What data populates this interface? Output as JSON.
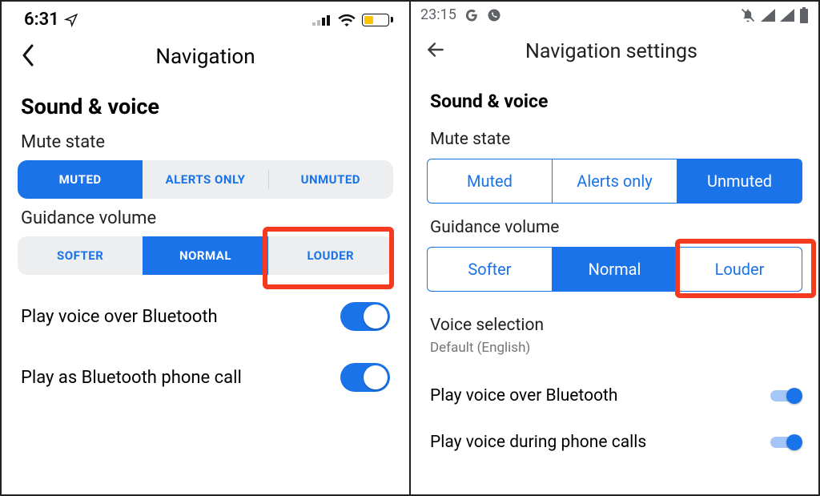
{
  "ios": {
    "status": {
      "time": "6:31"
    },
    "nav_title": "Navigation",
    "section_title": "Sound & voice",
    "mute_state": {
      "label": "Mute state",
      "options": [
        "MUTED",
        "ALERTS ONLY",
        "UNMUTED"
      ],
      "selected_index": 0
    },
    "guidance_volume": {
      "label": "Guidance volume",
      "options": [
        "SOFTER",
        "NORMAL",
        "LOUDER"
      ],
      "selected_index": 1,
      "highlighted_index": 2
    },
    "rows": {
      "play_bluetooth": {
        "label": "Play voice over Bluetooth",
        "on": true
      },
      "play_bt_call": {
        "label": "Play as Bluetooth phone call",
        "on": true
      }
    }
  },
  "android": {
    "status": {
      "time": "23:15"
    },
    "nav_title": "Navigation settings",
    "section_title": "Sound & voice",
    "mute_state": {
      "label": "Mute state",
      "options": [
        "Muted",
        "Alerts only",
        "Unmuted"
      ],
      "selected_index": 2
    },
    "guidance_volume": {
      "label": "Guidance volume",
      "options": [
        "Softer",
        "Normal",
        "Louder"
      ],
      "selected_index": 1,
      "highlighted_index": 2
    },
    "voice_selection": {
      "label": "Voice selection",
      "value": "Default (English)"
    },
    "rows": {
      "play_bluetooth": {
        "label": "Play voice over Bluetooth",
        "on": true
      },
      "play_during_calls": {
        "label": "Play voice during phone calls",
        "on": true
      }
    }
  },
  "colors": {
    "accent": "#1a73e8",
    "highlight": "#f43b1f"
  }
}
